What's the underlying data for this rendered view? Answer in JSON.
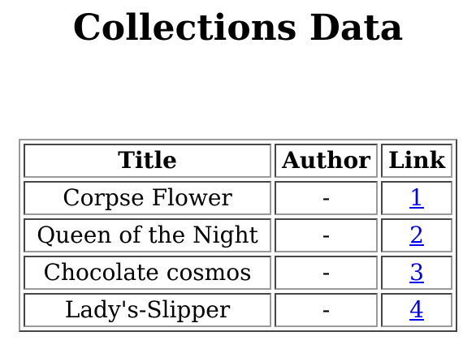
{
  "page": {
    "title": "Collections Data"
  },
  "table": {
    "headers": [
      "Title",
      "Author",
      "Link"
    ],
    "rows": [
      {
        "title": "Corpse Flower",
        "author": "-",
        "link": "1"
      },
      {
        "title": "Queen of the Night",
        "author": "-",
        "link": "2"
      },
      {
        "title": "Chocolate cosmos",
        "author": "-",
        "link": "3"
      },
      {
        "title": "Lady's-Slipper",
        "author": "-",
        "link": "4"
      }
    ]
  },
  "colors": {
    "link": "#0000ee",
    "border": "#9a9a9a",
    "background": "#ffffff"
  }
}
